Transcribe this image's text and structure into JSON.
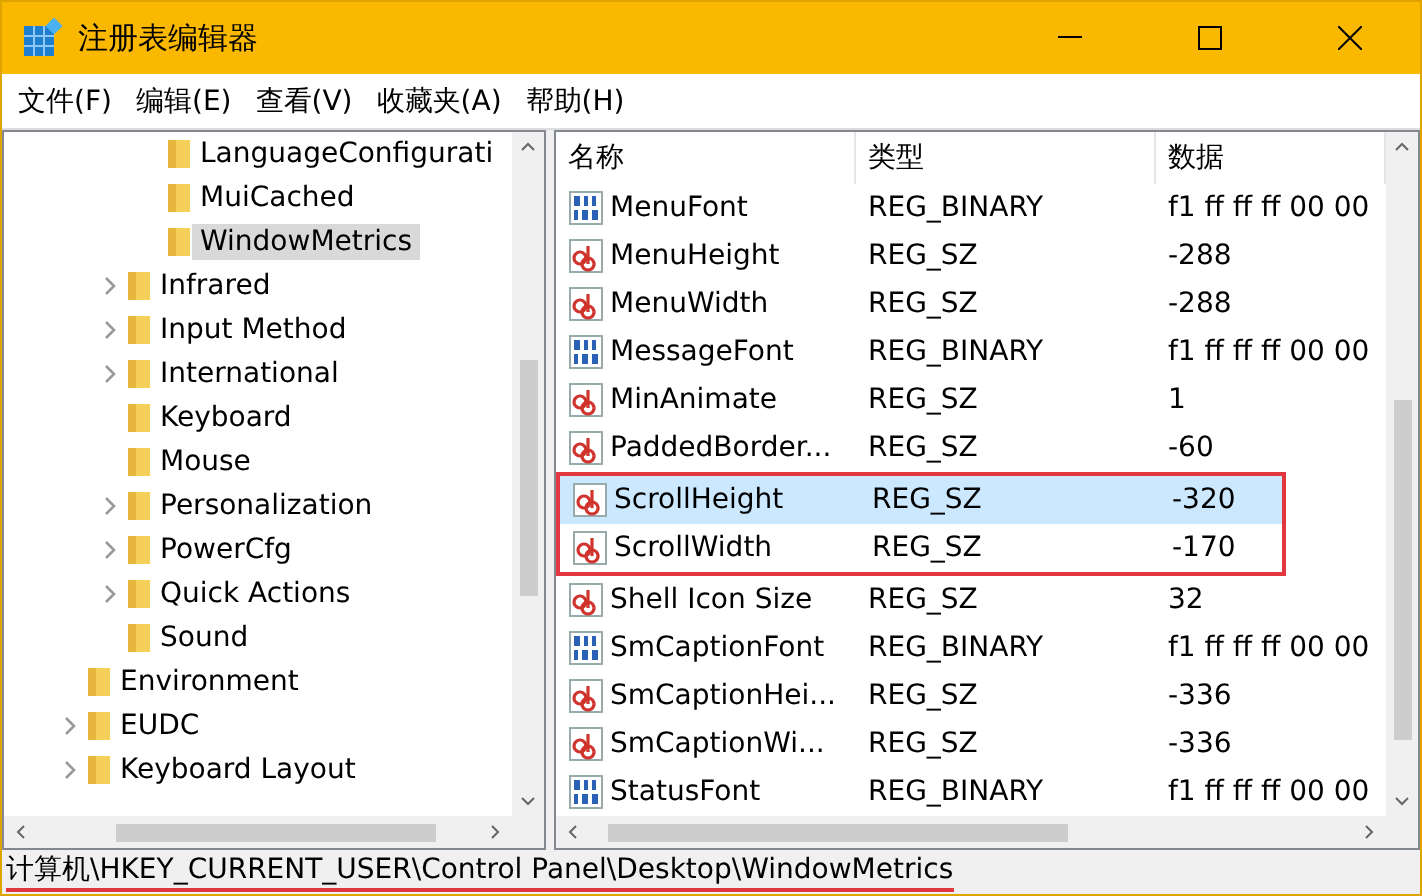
{
  "window": {
    "title": "注册表编辑器"
  },
  "menu": [
    "文件(F)",
    "编辑(E)",
    "查看(V)",
    "收藏夹(A)",
    "帮助(H)"
  ],
  "tree": [
    {
      "children": [
        {
          "children": [
            {
              "label": "LanguageConfigurati",
              "expandable": false,
              "selected": false
            },
            {
              "label": "MuiCached",
              "expandable": false,
              "selected": false
            },
            {
              "label": "WindowMetrics",
              "expandable": false,
              "selected": true
            }
          ]
        },
        {
          "label": "Infrared",
          "expandable": true,
          "selected": false
        },
        {
          "label": "Input Method",
          "expandable": true,
          "selected": false
        },
        {
          "label": "International",
          "expandable": true,
          "selected": false
        },
        {
          "label": "Keyboard",
          "expandable": false,
          "selected": false
        },
        {
          "label": "Mouse",
          "expandable": false,
          "selected": false
        },
        {
          "label": "Personalization",
          "expandable": true,
          "selected": false
        },
        {
          "label": "PowerCfg",
          "expandable": true,
          "selected": false
        },
        {
          "label": "Quick Actions",
          "expandable": true,
          "selected": false
        },
        {
          "label": "Sound",
          "expandable": false,
          "selected": false
        }
      ]
    },
    {
      "label": "Environment",
      "expandable": false,
      "selected": false
    },
    {
      "label": "EUDC",
      "expandable": true,
      "selected": false
    },
    {
      "label": "Keyboard Layout",
      "expandable": true,
      "selected": false
    }
  ],
  "table": {
    "columns": [
      "名称",
      "类型",
      "数据"
    ],
    "rows": [
      {
        "kind": "binary",
        "name": "MenuFont",
        "type": "REG_BINARY",
        "data": "f1 ff ff ff 00 00",
        "selected": false,
        "outlined": false
      },
      {
        "kind": "string",
        "name": "MenuHeight",
        "type": "REG_SZ",
        "data": "-288",
        "selected": false,
        "outlined": false
      },
      {
        "kind": "string",
        "name": "MenuWidth",
        "type": "REG_SZ",
        "data": "-288",
        "selected": false,
        "outlined": false
      },
      {
        "kind": "binary",
        "name": "MessageFont",
        "type": "REG_BINARY",
        "data": "f1 ff ff ff 00 00",
        "selected": false,
        "outlined": false
      },
      {
        "kind": "string",
        "name": "MinAnimate",
        "type": "REG_SZ",
        "data": "1",
        "selected": false,
        "outlined": false
      },
      {
        "kind": "string",
        "name": "PaddedBorder...",
        "type": "REG_SZ",
        "data": "-60",
        "selected": false,
        "outlined": false
      },
      {
        "kind": "string",
        "name": "ScrollHeight",
        "type": "REG_SZ",
        "data": "-320",
        "selected": true,
        "outlined": true
      },
      {
        "kind": "string",
        "name": "ScrollWidth",
        "type": "REG_SZ",
        "data": "-170",
        "selected": false,
        "outlined": true
      },
      {
        "kind": "string",
        "name": "Shell Icon Size",
        "type": "REG_SZ",
        "data": "32",
        "selected": false,
        "outlined": false
      },
      {
        "kind": "binary",
        "name": "SmCaptionFont",
        "type": "REG_BINARY",
        "data": "f1 ff ff ff 00 00",
        "selected": false,
        "outlined": false
      },
      {
        "kind": "string",
        "name": "SmCaptionHei...",
        "type": "REG_SZ",
        "data": "-336",
        "selected": false,
        "outlined": false
      },
      {
        "kind": "string",
        "name": "SmCaptionWi...",
        "type": "REG_SZ",
        "data": "-336",
        "selected": false,
        "outlined": false
      },
      {
        "kind": "binary",
        "name": "StatusFont",
        "type": "REG_BINARY",
        "data": "f1 ff ff ff 00 00",
        "selected": false,
        "outlined": false
      }
    ]
  },
  "status_bar": {
    "path": "计算机\\HKEY_CURRENT_USER\\Control Panel\\Desktop\\WindowMetrics",
    "underlined": true
  }
}
